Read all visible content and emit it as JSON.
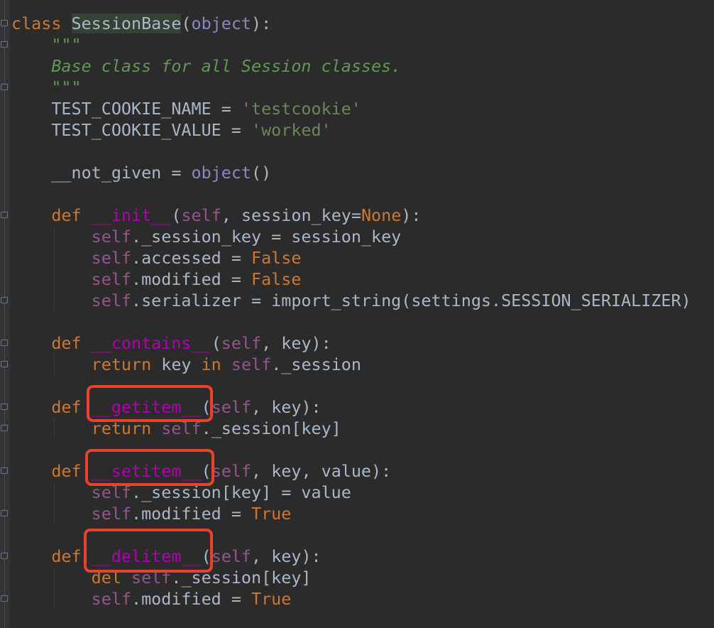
{
  "editor": {
    "language": "Python",
    "lines": [
      [
        {
          "t": "class",
          "c": "kw"
        },
        {
          "t": " "
        },
        {
          "t": "SessionBase",
          "c": "cls"
        },
        {
          "t": "("
        },
        {
          "t": "object",
          "c": "builtin"
        },
        {
          "t": "):"
        }
      ],
      [
        {
          "t": "    "
        },
        {
          "t": "\"\"\"",
          "c": "doc"
        }
      ],
      [
        {
          "t": "    "
        },
        {
          "t": "Base class for all Session classes.",
          "c": "docital"
        }
      ],
      [
        {
          "t": "    "
        },
        {
          "t": "\"\"\"",
          "c": "doc"
        }
      ],
      [
        {
          "t": "    TEST_COOKIE_NAME = "
        },
        {
          "t": "'testcookie'",
          "c": "str"
        }
      ],
      [
        {
          "t": "    TEST_COOKIE_VALUE = "
        },
        {
          "t": "'worked'",
          "c": "str"
        }
      ],
      [
        {
          "t": ""
        }
      ],
      [
        {
          "t": "    __not_given = "
        },
        {
          "t": "object",
          "c": "builtin"
        },
        {
          "t": "()"
        }
      ],
      [
        {
          "t": ""
        }
      ],
      [
        {
          "t": "    "
        },
        {
          "t": "def",
          "c": "kw"
        },
        {
          "t": " "
        },
        {
          "t": "__init__",
          "c": "magic"
        },
        {
          "t": "("
        },
        {
          "t": "self",
          "c": "selfkw"
        },
        {
          "t": ", session_key="
        },
        {
          "t": "None",
          "c": "kw"
        },
        {
          "t": "):"
        }
      ],
      [
        {
          "t": "        "
        },
        {
          "t": "self",
          "c": "selfkw"
        },
        {
          "t": "._session_key = session_key"
        }
      ],
      [
        {
          "t": "        "
        },
        {
          "t": "self",
          "c": "selfkw"
        },
        {
          "t": ".accessed = "
        },
        {
          "t": "False",
          "c": "kw"
        }
      ],
      [
        {
          "t": "        "
        },
        {
          "t": "self",
          "c": "selfkw"
        },
        {
          "t": ".modified = "
        },
        {
          "t": "False",
          "c": "kw"
        }
      ],
      [
        {
          "t": "        "
        },
        {
          "t": "self",
          "c": "selfkw"
        },
        {
          "t": ".serializer = import_string(settings.SESSION_SERIALIZER)"
        }
      ],
      [
        {
          "t": ""
        }
      ],
      [
        {
          "t": "    "
        },
        {
          "t": "def",
          "c": "kw"
        },
        {
          "t": " "
        },
        {
          "t": "__contains__",
          "c": "magic"
        },
        {
          "t": "("
        },
        {
          "t": "self",
          "c": "selfkw"
        },
        {
          "t": ", key):"
        }
      ],
      [
        {
          "t": "        "
        },
        {
          "t": "return",
          "c": "kw"
        },
        {
          "t": " key "
        },
        {
          "t": "in",
          "c": "kw"
        },
        {
          "t": " "
        },
        {
          "t": "self",
          "c": "selfkw"
        },
        {
          "t": "._session"
        }
      ],
      [
        {
          "t": ""
        }
      ],
      [
        {
          "t": "    "
        },
        {
          "t": "def",
          "c": "kw"
        },
        {
          "t": " "
        },
        {
          "t": "__getitem__",
          "c": "magic"
        },
        {
          "t": "("
        },
        {
          "t": "self",
          "c": "selfkw"
        },
        {
          "t": ", key):"
        }
      ],
      [
        {
          "t": "        "
        },
        {
          "t": "return",
          "c": "kw"
        },
        {
          "t": " "
        },
        {
          "t": "self",
          "c": "selfkw"
        },
        {
          "t": "._session[key]"
        }
      ],
      [
        {
          "t": ""
        }
      ],
      [
        {
          "t": "    "
        },
        {
          "t": "def",
          "c": "kw"
        },
        {
          "t": " "
        },
        {
          "t": "__setitem__",
          "c": "magic"
        },
        {
          "t": "("
        },
        {
          "t": "self",
          "c": "selfkw"
        },
        {
          "t": ", key, value):"
        }
      ],
      [
        {
          "t": "        "
        },
        {
          "t": "self",
          "c": "selfkw"
        },
        {
          "t": "._session[key] = value"
        }
      ],
      [
        {
          "t": "        "
        },
        {
          "t": "self",
          "c": "selfkw"
        },
        {
          "t": ".modified = "
        },
        {
          "t": "True",
          "c": "kw"
        }
      ],
      [
        {
          "t": ""
        }
      ],
      [
        {
          "t": "    "
        },
        {
          "t": "def",
          "c": "kw"
        },
        {
          "t": " "
        },
        {
          "t": "__delitem__",
          "c": "magic"
        },
        {
          "t": "("
        },
        {
          "t": "self",
          "c": "selfkw"
        },
        {
          "t": ", key):"
        }
      ],
      [
        {
          "t": "        "
        },
        {
          "t": "del",
          "c": "kw"
        },
        {
          "t": " "
        },
        {
          "t": "self",
          "c": "selfkw"
        },
        {
          "t": "._session[key]"
        }
      ],
      [
        {
          "t": "        "
        },
        {
          "t": "self",
          "c": "selfkw"
        },
        {
          "t": ".modified = "
        },
        {
          "t": "True",
          "c": "kw"
        }
      ]
    ]
  },
  "colors": {
    "background": "#2b2b2b",
    "gutter": "#313335",
    "keyword": "#cc7832",
    "docstring": "#629755",
    "string": "#6a8759",
    "magic_method": "#b200b2",
    "self": "#94558d",
    "builtin": "#8888c6",
    "default_text": "#a9b7c6",
    "annotation_box": "#e8432a"
  },
  "annotations": {
    "highlighted_methods": [
      "__getitem__",
      "__setitem__",
      "__delitem__"
    ]
  }
}
